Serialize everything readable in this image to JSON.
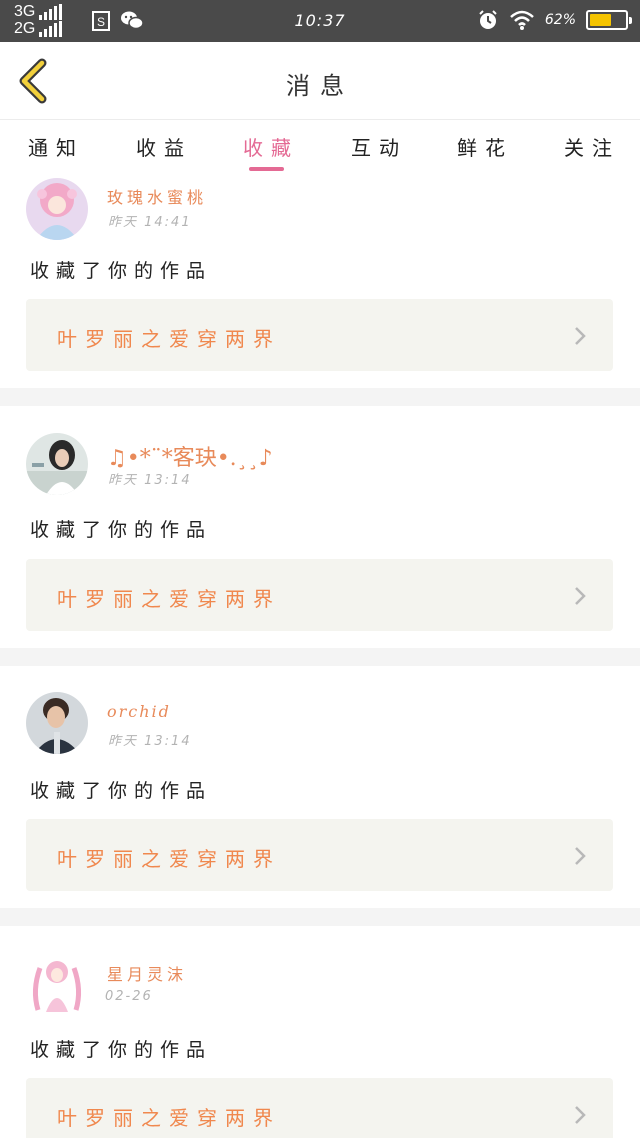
{
  "status_bar": {
    "network_top": "3G",
    "network_bottom": "2G",
    "time": "10:37",
    "battery_percent": "62%",
    "battery_level": 0.62
  },
  "header": {
    "title": "消息"
  },
  "tabs": [
    {
      "label": "通知"
    },
    {
      "label": "收益"
    },
    {
      "label": "收藏"
    },
    {
      "label": "互动"
    },
    {
      "label": "鲜花"
    },
    {
      "label": "关注"
    }
  ],
  "active_tab": "收藏",
  "messages": [
    {
      "username": "玫瑰水蜜桃",
      "time": "昨天 14:41",
      "action": "收藏了你的作品",
      "work_title": "叶罗丽之爱穿两界"
    },
    {
      "username": "♫•*¨*客玦•.¸¸♪",
      "time": "昨天 13:14",
      "action": "收藏了你的作品",
      "work_title": "叶罗丽之爱穿两界"
    },
    {
      "username": "orchid",
      "time": "昨天 13:14",
      "action": "收藏了你的作品",
      "work_title": "叶罗丽之爱穿两界"
    },
    {
      "username": "星月灵沫",
      "time": "02-26",
      "action": "收藏了你的作品",
      "work_title": "叶罗丽之爱穿两界"
    }
  ],
  "colors": {
    "accent_pink": "#e46a94",
    "username_orange": "#e88a5a",
    "work_title_orange": "#f0884e",
    "battery_yellow": "#f5c400"
  }
}
